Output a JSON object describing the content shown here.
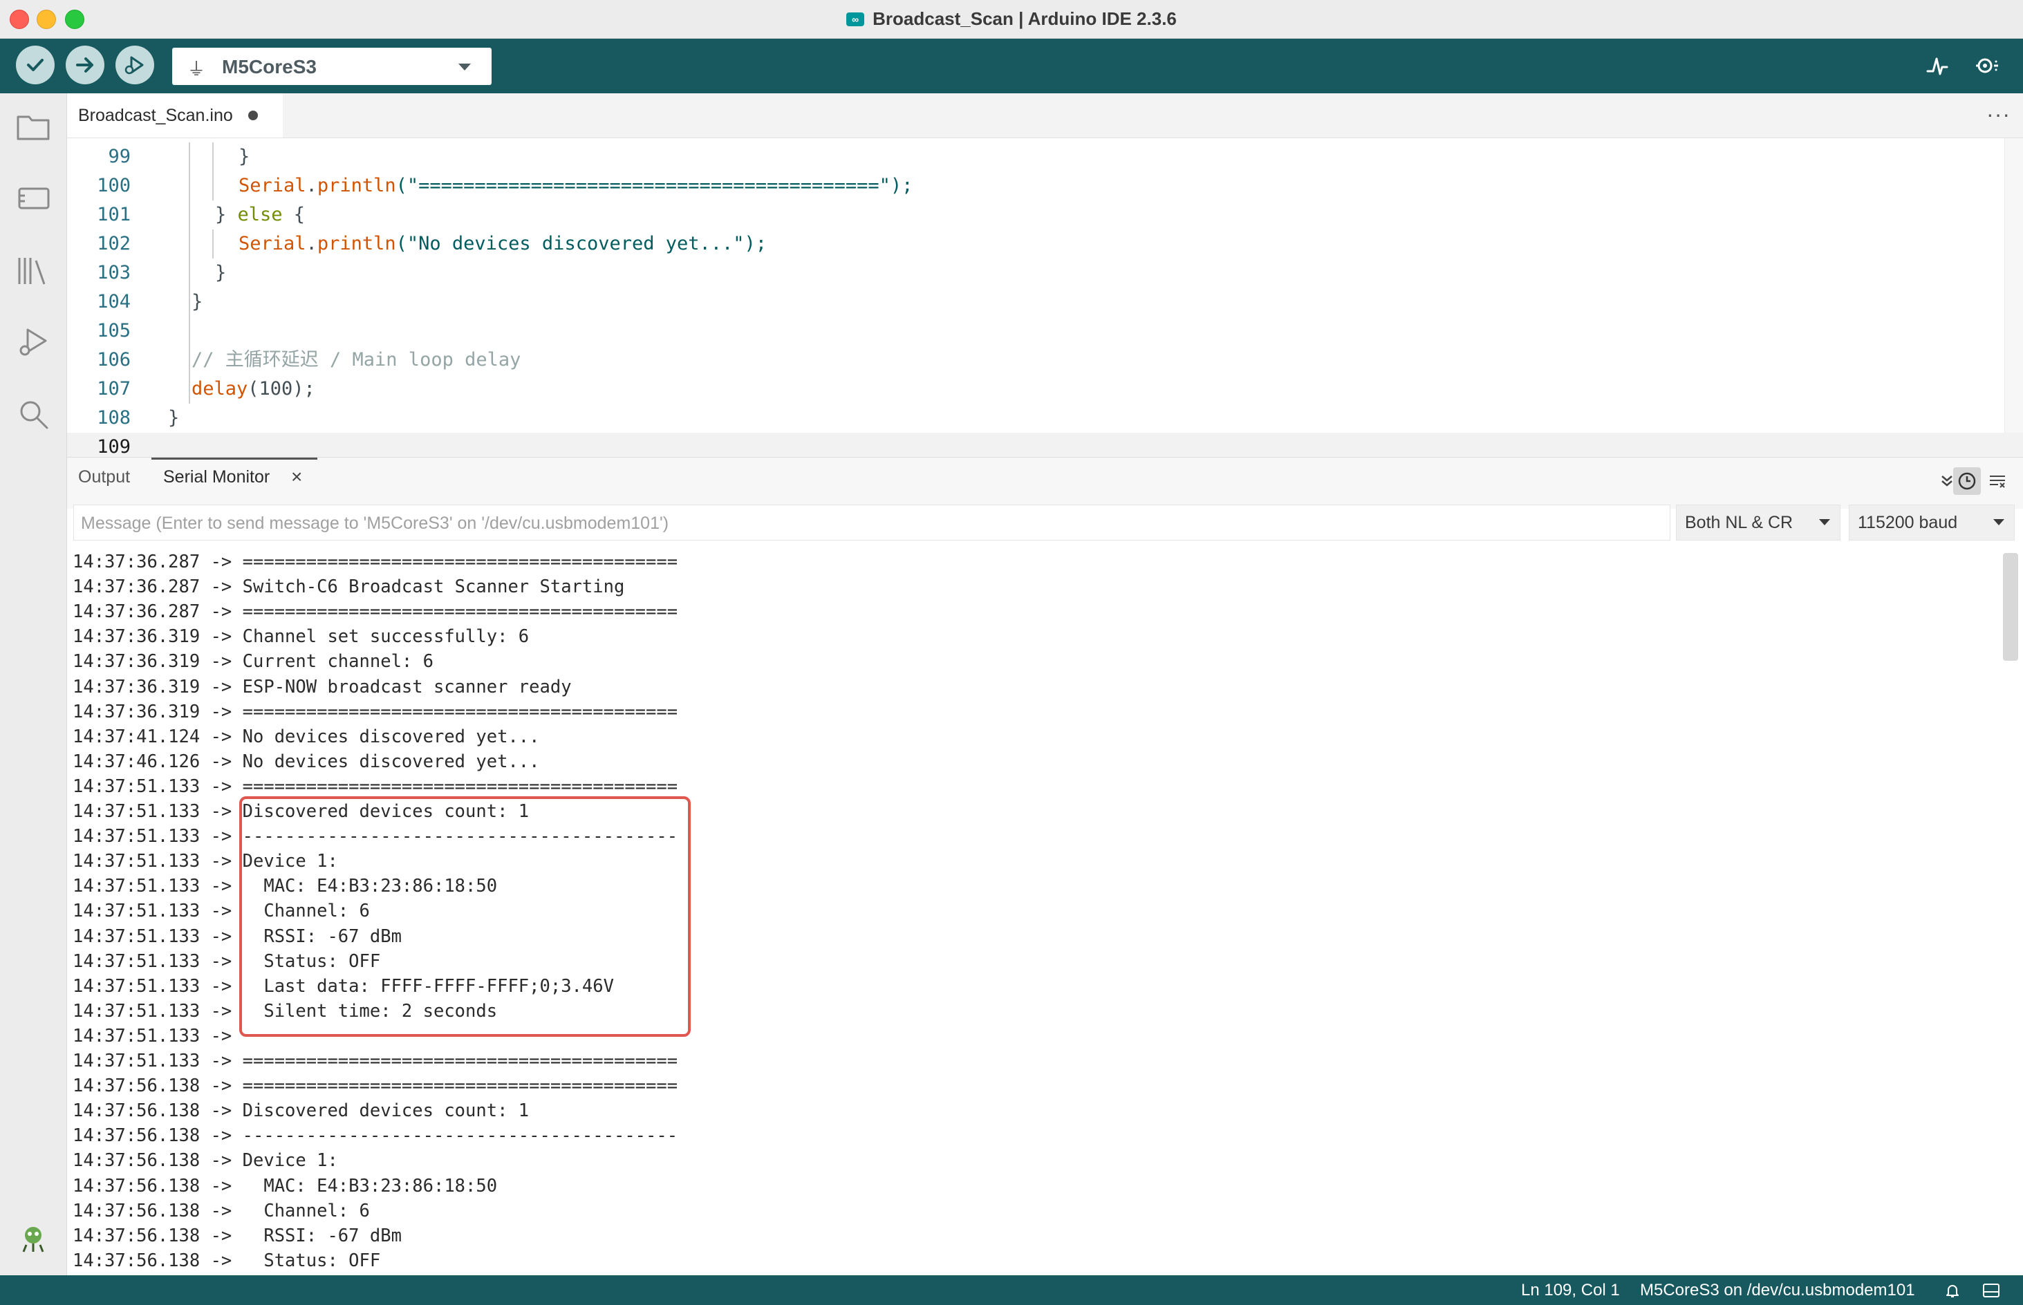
{
  "window": {
    "title": "Broadcast_Scan | Arduino IDE 2.3.6",
    "app_icon": "arduino-logo-icon"
  },
  "toolbar": {
    "verify_icon": "check-icon",
    "upload_icon": "arrow-right-icon",
    "debug_icon": "debug-play-icon",
    "board_icon": "usb-icon",
    "board": "M5CoreS3",
    "plotter_icon": "pulse-icon",
    "serial_monitor_icon": "serial-monitor-icon"
  },
  "activity_bar": {
    "items": [
      "folder-icon",
      "board-manager-icon",
      "library-icon",
      "debug-icon",
      "search-icon"
    ],
    "profile_icon": "arduino-mascot-icon"
  },
  "editor": {
    "tab": {
      "filename": "Broadcast_Scan.ino",
      "modified": true
    },
    "more_label": "···",
    "lines": [
      {
        "num": "99",
        "parts": [
          {
            "t": "}",
            "c": "plain"
          }
        ]
      },
      {
        "num": "100",
        "parts": [
          {
            "t": "Serial",
            "c": "fn"
          },
          {
            "t": ".",
            "c": "plain"
          },
          {
            "t": "println",
            "c": "fn"
          },
          {
            "t": "(\"=========================================\");",
            "c": "str"
          }
        ]
      },
      {
        "num": "101",
        "parts": [
          {
            "t": "} ",
            "c": "plain"
          },
          {
            "t": "else",
            "c": "ctl"
          },
          {
            "t": " {",
            "c": "plain"
          }
        ]
      },
      {
        "num": "102",
        "parts": [
          {
            "t": "Serial",
            "c": "fn"
          },
          {
            "t": ".",
            "c": "plain"
          },
          {
            "t": "println",
            "c": "fn"
          },
          {
            "t": "(\"No devices discovered yet...\");",
            "c": "str"
          }
        ]
      },
      {
        "num": "103",
        "parts": [
          {
            "t": "}",
            "c": "plain"
          }
        ]
      },
      {
        "num": "104",
        "parts": [
          {
            "t": "}",
            "c": "plain"
          }
        ]
      },
      {
        "num": "105",
        "parts": []
      },
      {
        "num": "106",
        "parts": [
          {
            "t": "// 主循环延迟 / Main loop delay",
            "c": "cmt"
          }
        ]
      },
      {
        "num": "107",
        "parts": [
          {
            "t": "delay",
            "c": "fn"
          },
          {
            "t": "(100);",
            "c": "plain"
          }
        ]
      },
      {
        "num": "108",
        "parts": [
          {
            "t": "}",
            "c": "plain"
          }
        ]
      },
      {
        "num": "109",
        "parts": []
      }
    ]
  },
  "panel": {
    "tabs": {
      "output": "Output",
      "serial_monitor": "Serial Monitor"
    },
    "close_icon": "close-icon",
    "icons": [
      "collapse-icon",
      "timestamp-clock-icon",
      "clear-output-icon"
    ],
    "message_placeholder": "Message (Enter to send message to 'M5CoreS3' on '/dev/cu.usbmodem101')",
    "line_ending": "Both NL & CR",
    "baud": "115200 baud",
    "serial_lines": [
      "14:37:36.287 -> =========================================",
      "14:37:36.287 -> Switch-C6 Broadcast Scanner Starting",
      "14:37:36.287 -> =========================================",
      "14:37:36.319 -> Channel set successfully: 6",
      "14:37:36.319 -> Current channel: 6",
      "14:37:36.319 -> ESP-NOW broadcast scanner ready",
      "14:37:36.319 -> =========================================",
      "14:37:41.124 -> No devices discovered yet...",
      "14:37:46.126 -> No devices discovered yet...",
      "14:37:51.133 -> =========================================",
      "14:37:51.133 -> Discovered devices count: 1",
      "14:37:51.133 -> -----------------------------------------",
      "14:37:51.133 -> Device 1:",
      "14:37:51.133 ->   MAC: E4:B3:23:86:18:50",
      "14:37:51.133 ->   Channel: 6",
      "14:37:51.133 ->   RSSI: -67 dBm",
      "14:37:51.133 ->   Status: OFF",
      "14:37:51.133 ->   Last data: FFFF-FFFF-FFFF;0;3.46V",
      "14:37:51.133 ->   Silent time: 2 seconds",
      "14:37:51.133 -> ",
      "14:37:51.133 -> =========================================",
      "14:37:56.138 -> =========================================",
      "14:37:56.138 -> Discovered devices count: 1",
      "14:37:56.138 -> -----------------------------------------",
      "14:37:56.138 -> Device 1:",
      "14:37:56.138 ->   MAC: E4:B3:23:86:18:50",
      "14:37:56.138 ->   Channel: 6",
      "14:37:56.138 ->   RSSI: -67 dBm",
      "14:37:56.138 ->   Status: OFF"
    ],
    "highlight_color": "#e0574f"
  },
  "statusbar": {
    "position": "Ln 109, Col 1",
    "port": "M5CoreS3 on /dev/cu.usbmodem101",
    "icons": [
      "bell-icon",
      "toggle-panel-icon"
    ]
  },
  "colors": {
    "toolbar": "#17595e",
    "accent": "#00979c"
  }
}
